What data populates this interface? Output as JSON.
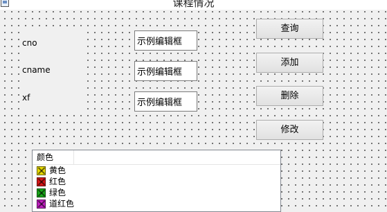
{
  "window": {
    "title": "课程情况"
  },
  "fields": [
    {
      "label": "cno",
      "value": "示例编辑框"
    },
    {
      "label": "cname",
      "value": "示例编辑框"
    },
    {
      "label": "xf",
      "value": "示例编辑框"
    }
  ],
  "buttons": {
    "query": "查询",
    "add": "添加",
    "delete": "删除",
    "modify": "修改"
  },
  "list": {
    "column_header": "颜色",
    "items": [
      {
        "label": "黄色",
        "icon": "color-icon",
        "color": "#e6d800"
      },
      {
        "label": "红色",
        "icon": "color-icon",
        "color": "#d81818"
      },
      {
        "label": "绿色",
        "icon": "color-icon",
        "color": "#1aa81a"
      },
      {
        "label": "道红色",
        "icon": "color-icon",
        "color": "#c020c0"
      }
    ]
  }
}
